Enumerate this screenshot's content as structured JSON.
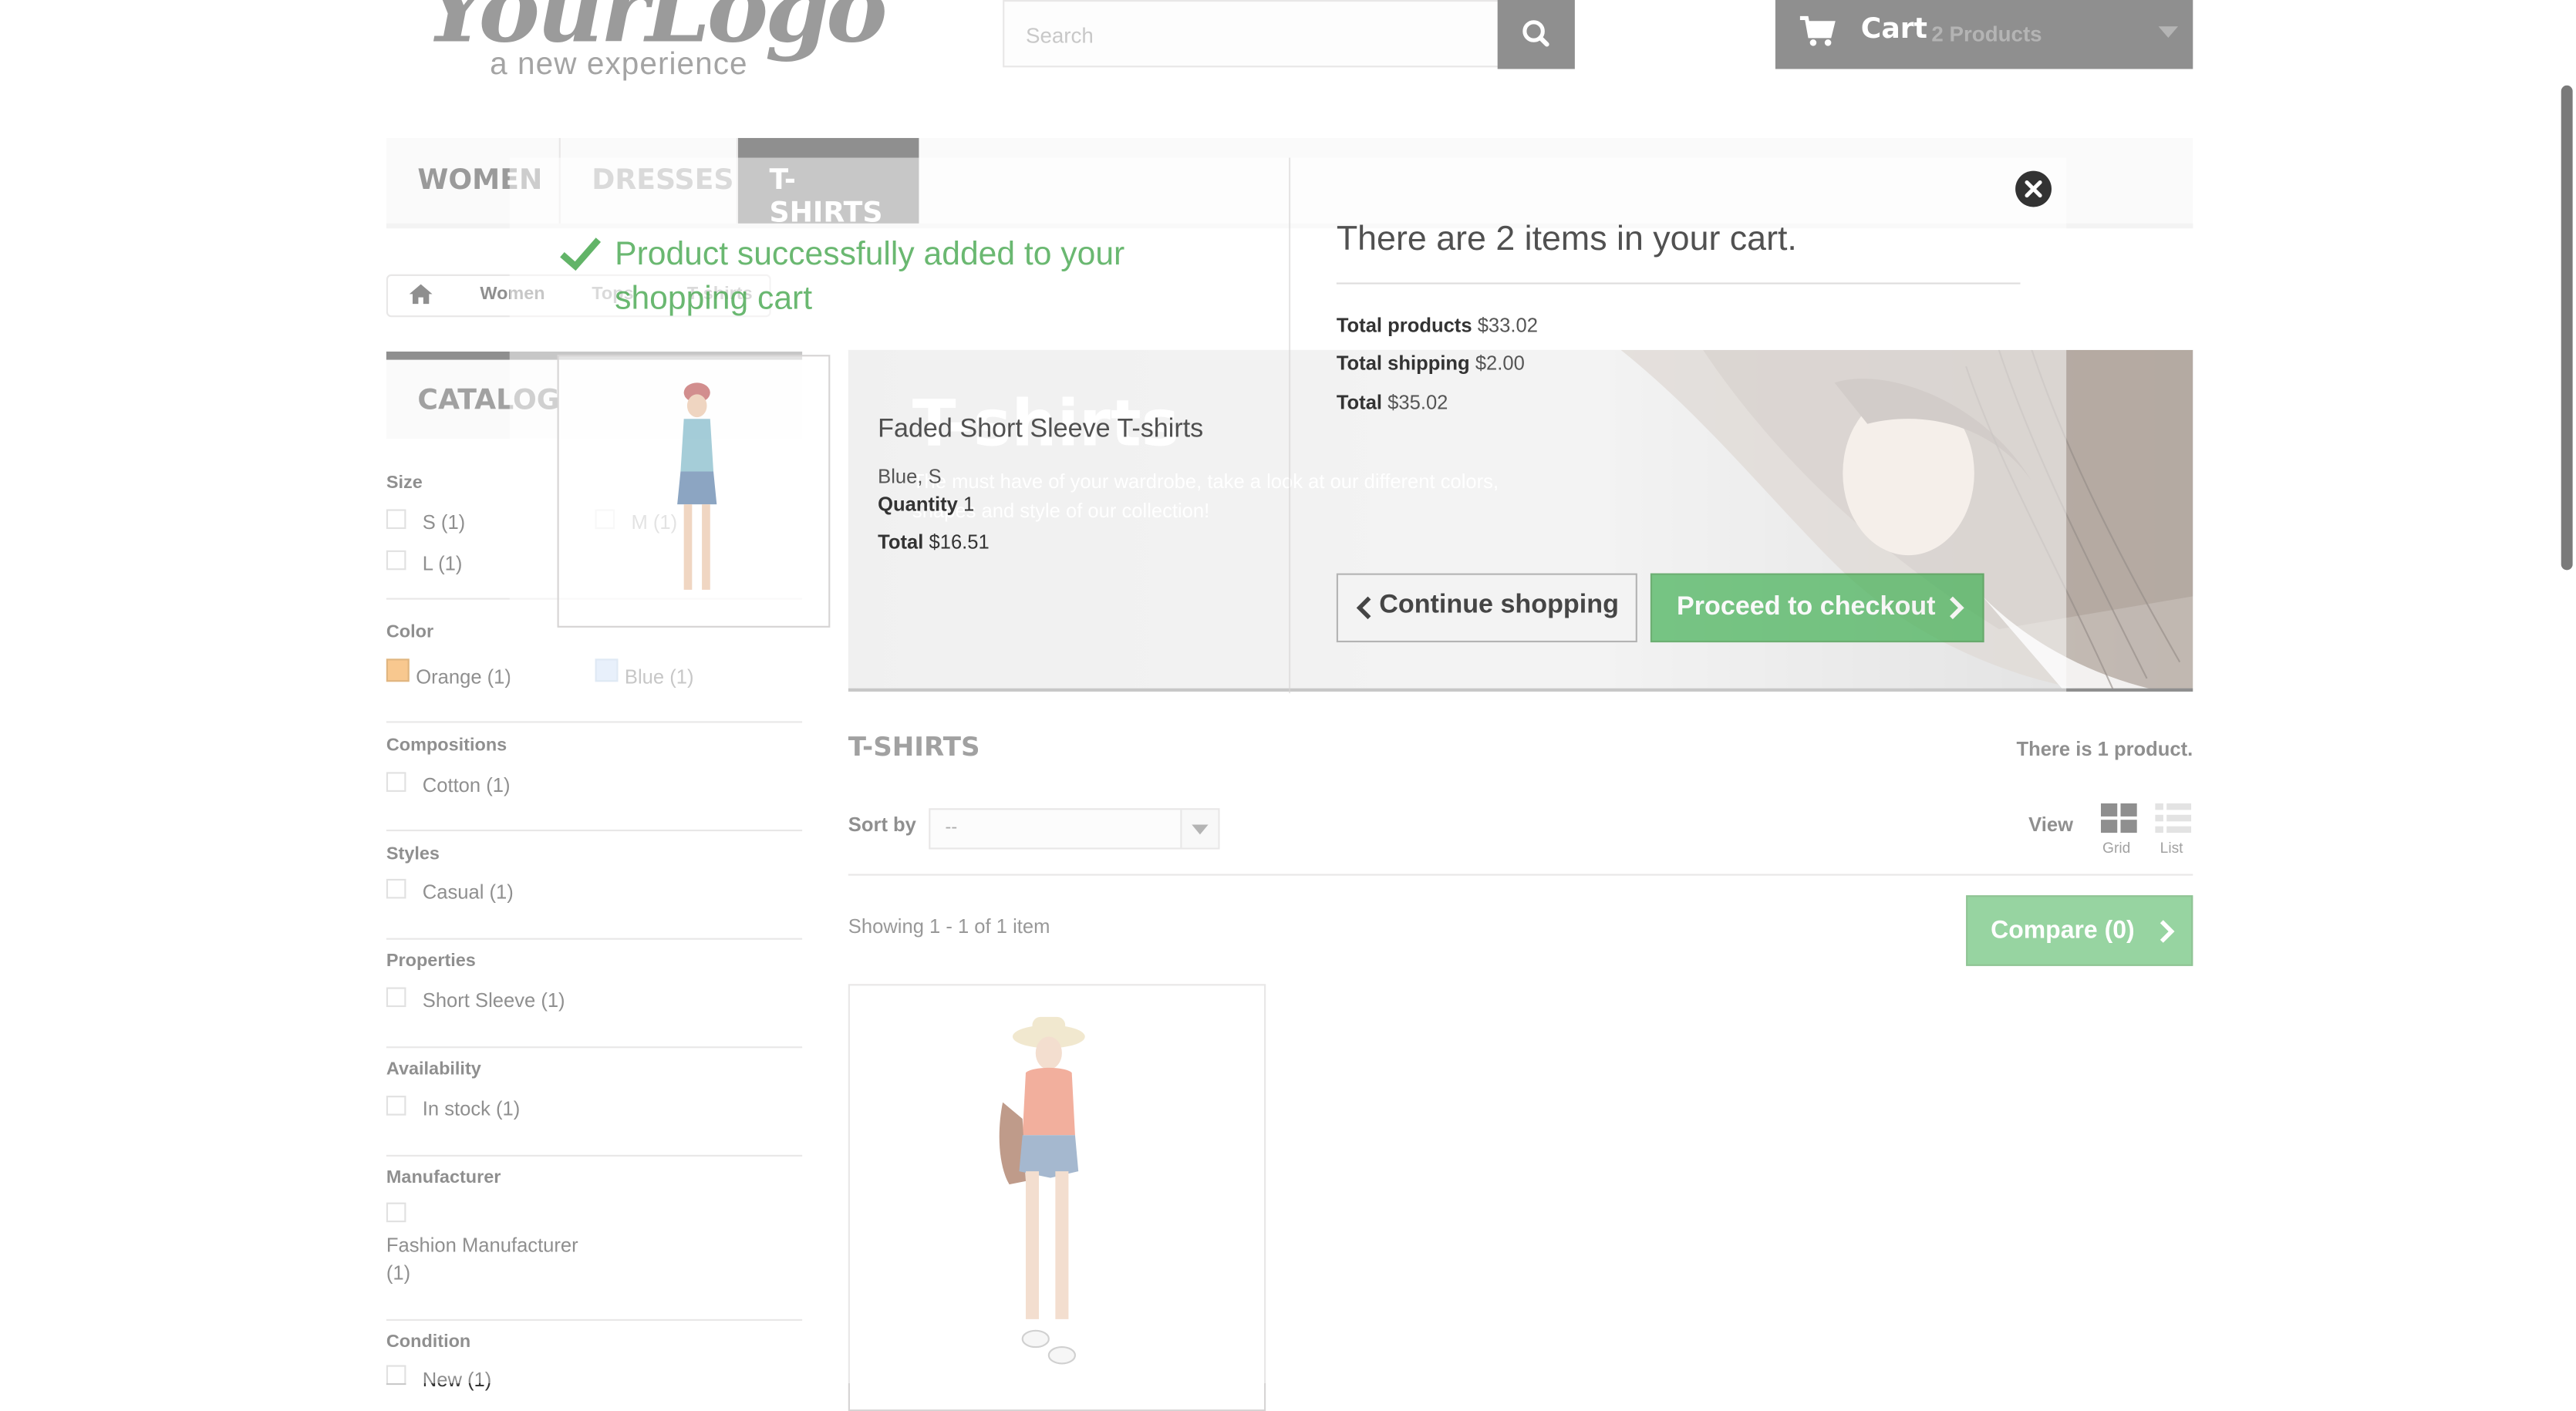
{
  "header": {
    "logo_main": "YourLogo",
    "logo_sub": "a new experience",
    "search_placeholder": "Search",
    "cart_title": "Cart",
    "cart_count": "2 Products"
  },
  "menu": {
    "items": [
      "WOMEN",
      "DRESSES",
      "T-SHIRTS"
    ],
    "active": "T-SHIRTS"
  },
  "breadcrumb": {
    "items": [
      "Women",
      "Tops",
      "T-shirts"
    ]
  },
  "catalog": {
    "title": "CATALOG",
    "filters": {
      "size": {
        "label": "Size",
        "options": [
          "S (1)",
          "M (1)",
          "L (1)"
        ]
      },
      "color": {
        "label": "Color",
        "options": [
          "Orange (1)",
          "Blue (1)"
        ],
        "swatches": [
          "#f39c33",
          "#a9c9ef"
        ]
      },
      "compositions": {
        "label": "Compositions",
        "options": [
          "Cotton (1)"
        ]
      },
      "styles": {
        "label": "Styles",
        "options": [
          "Casual (1)"
        ]
      },
      "properties": {
        "label": "Properties",
        "options": [
          "Short Sleeve (1)"
        ]
      },
      "availability": {
        "label": "Availability",
        "options": [
          "In stock (1)"
        ]
      },
      "manufacturer": {
        "label": "Manufacturer",
        "options": [
          "Fashion Manufacturer",
          "(1)"
        ]
      },
      "condition": {
        "label": "Condition",
        "options": [
          "New (1)"
        ]
      }
    }
  },
  "category": {
    "banner_title": "T-shirts",
    "banner_desc": "The must have of your wardrobe, take a look at our different colors, shapes and style of our collection!",
    "heading": "T-SHIRTS",
    "product_count": "There is 1 product.",
    "sort_label": "Sort by",
    "sort_value": "--",
    "view_label": "View",
    "view_grid": "Grid",
    "view_list": "List",
    "showing": "Showing 1 - 1 of 1 item",
    "compare": "Compare (0)"
  },
  "layer_cart": {
    "added_message": "Product successfully added to your shopping cart",
    "product_name": "Faded Short Sleeve T-shirts",
    "product_attributes": "Blue, S",
    "quantity_label": "Quantity",
    "quantity_value": "1",
    "total_label": "Total",
    "total_value": "$16.51",
    "summary_title": "There are 2 items in your cart.",
    "total_products_label": "Total products",
    "total_products_value": "$33.02",
    "total_shipping_label": "Total shipping",
    "total_shipping_value": "$2.00",
    "cart_total_label": "Total",
    "cart_total_value": "$35.02",
    "continue_label": "Continue shopping",
    "checkout_label": "Proceed to checkout"
  },
  "colors": {
    "dark": "#333333",
    "green": "#43b155",
    "success_text": "#46a74e"
  }
}
